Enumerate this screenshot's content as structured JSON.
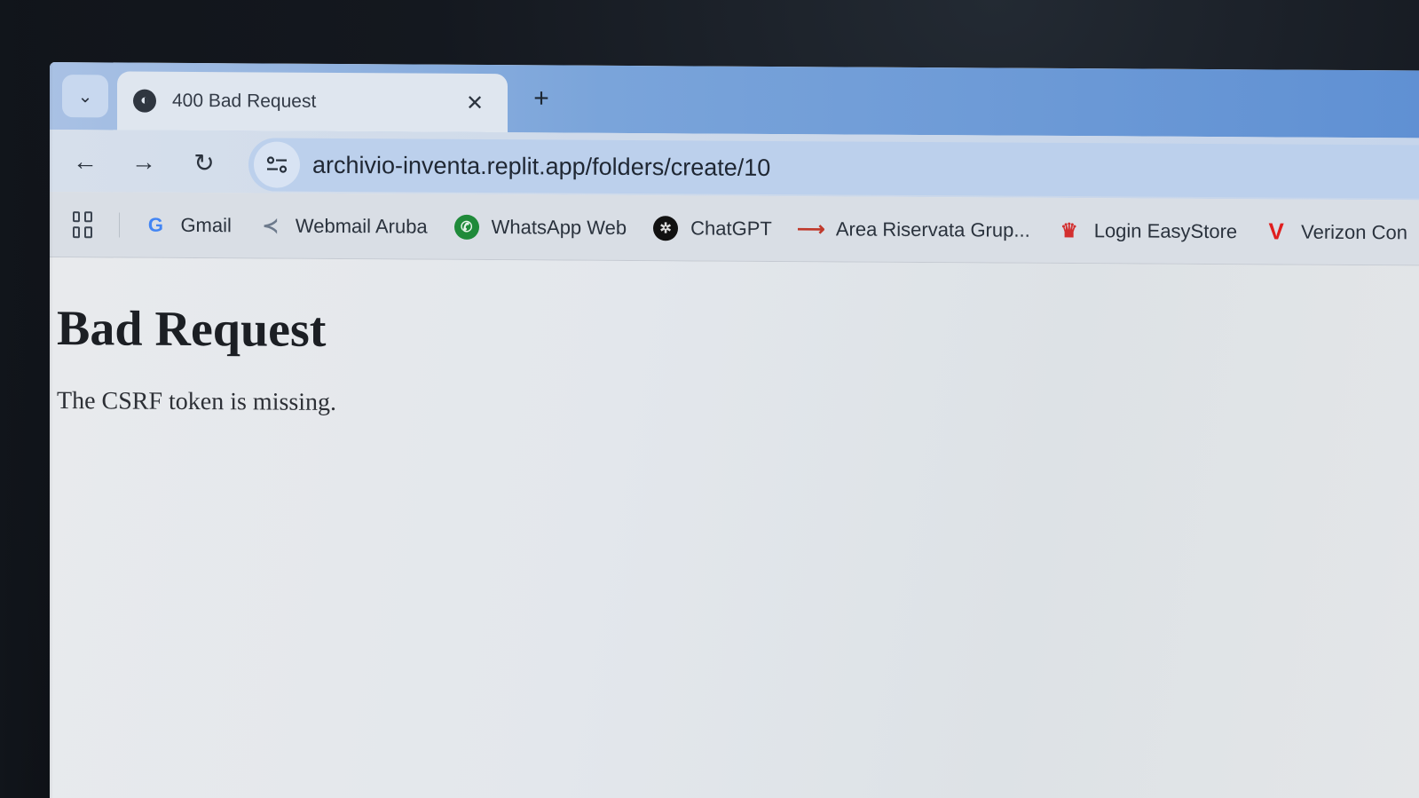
{
  "tab": {
    "title": "400 Bad Request",
    "search_icon": "chevron-down-icon",
    "favicon": "globe-icon",
    "close_icon": "close-icon",
    "new_tab_icon": "plus-icon"
  },
  "toolbar": {
    "back_icon": "arrow-left-icon",
    "forward_icon": "arrow-right-icon",
    "reload_icon": "reload-icon",
    "site_info_icon": "tune-icon",
    "url": "archivio-inventa.replit.app/folders/create/10"
  },
  "bookmarks": {
    "items": [
      {
        "label": "Gmail",
        "icon": "google-icon",
        "color": "#4285f4"
      },
      {
        "label": "Webmail Aruba",
        "icon": "aruba-icon",
        "color": "#6d7a8c"
      },
      {
        "label": "WhatsApp Web",
        "icon": "whatsapp-icon",
        "color": "#1f8a3a"
      },
      {
        "label": "ChatGPT",
        "icon": "openai-icon",
        "color": "#111111"
      },
      {
        "label": "Area Riservata Grup...",
        "icon": "area-riservata-icon",
        "color": "#c0392b"
      },
      {
        "label": "Login EasyStore",
        "icon": "easystore-icon",
        "color": "#d32f2f"
      },
      {
        "label": "Verizon Con",
        "icon": "verizon-icon",
        "color": "#e01e1e"
      }
    ]
  },
  "page": {
    "title": "Bad Request",
    "message": "The CSRF token is missing."
  }
}
